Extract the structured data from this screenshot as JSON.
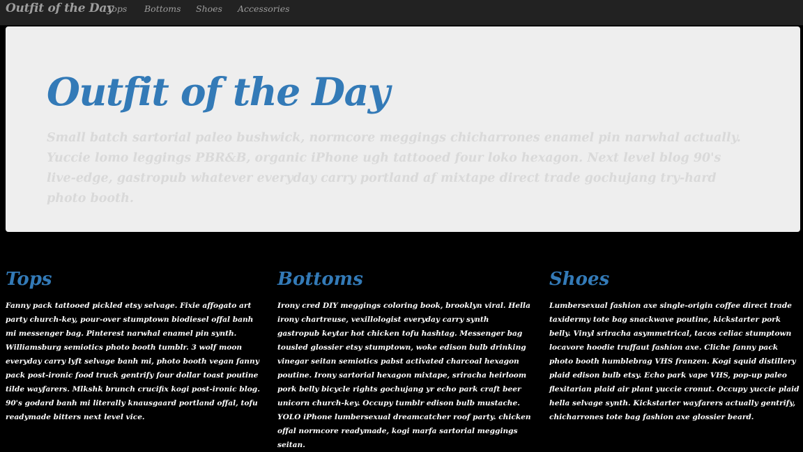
{
  "navbar": {
    "brand": "Outfit of the Day",
    "links": [
      "Tops",
      "Bottoms",
      "Shoes",
      "Accessories"
    ]
  },
  "jumbotron": {
    "title": "Outfit of the Day",
    "text": "Small batch sartorial paleo bushwick, normcore meggings chicharrones enamel pin narwhal actually. Yuccie lomo leggings PBR&B, organic iPhone ugh tattooed four loko hexagon. Next level blog 90's live-edge, gastropub whatever everyday carry portland af mixtape direct trade gochujang try-hard photo booth."
  },
  "columns": [
    {
      "title": "Tops",
      "text": "Fanny pack tattooed pickled etsy selvage. Fixie affogato art party church-key, pour-over stumptown biodiesel offal banh mi messenger bag. Pinterest narwhal enamel pin synth. Williamsburg semiotics photo booth tumblr. 3 wolf moon everyday carry lyft selvage banh mi, photo booth vegan fanny pack post-ironic food truck gentrify four dollar toast poutine tilde wayfarers. Mlkshk brunch crucifix kogi post-ironic blog. 90's godard banh mi literally knausgaard portland offal, tofu readymade bitters next level vice."
    },
    {
      "title": "Bottoms",
      "text": "Irony cred DIY meggings coloring book, brooklyn viral. Hella irony chartreuse, vexillologist everyday carry synth gastropub keytar hot chicken tofu hashtag. Messenger bag tousled glossier etsy stumptown, woke edison bulb drinking vinegar seitan semiotics pabst activated charcoal hexagon poutine. Irony sartorial hexagon mixtape, sriracha heirloom pork belly bicycle rights gochujang yr echo park craft beer unicorn church-key. Occupy tumblr edison bulb mustache. YOLO iPhone lumbersexual dreamcatcher roof party. chicken offal normcore readymade, kogi marfa sartorial meggings seitan."
    },
    {
      "title": "Shoes",
      "text": "Lumbersexual fashion axe single-origin coffee direct trade taxidermy tote bag snackwave poutine, kickstarter pork belly. Vinyl sriracha asymmetrical, tacos celiac stumptown locavore hoodie truffaut fashion axe. Cliche fanny pack photo booth humblebrag VHS franzen. Kogi squid distillery plaid edison bulb etsy. Echo park vape VHS, pop-up paleo flexitarian plaid air plant yuccie cronut. Occupy yuccie plaid hella selvage synth. Kickstarter wayfarers actually gentrify, chicharrones tote bag fashion axe glossier beard."
    }
  ]
}
